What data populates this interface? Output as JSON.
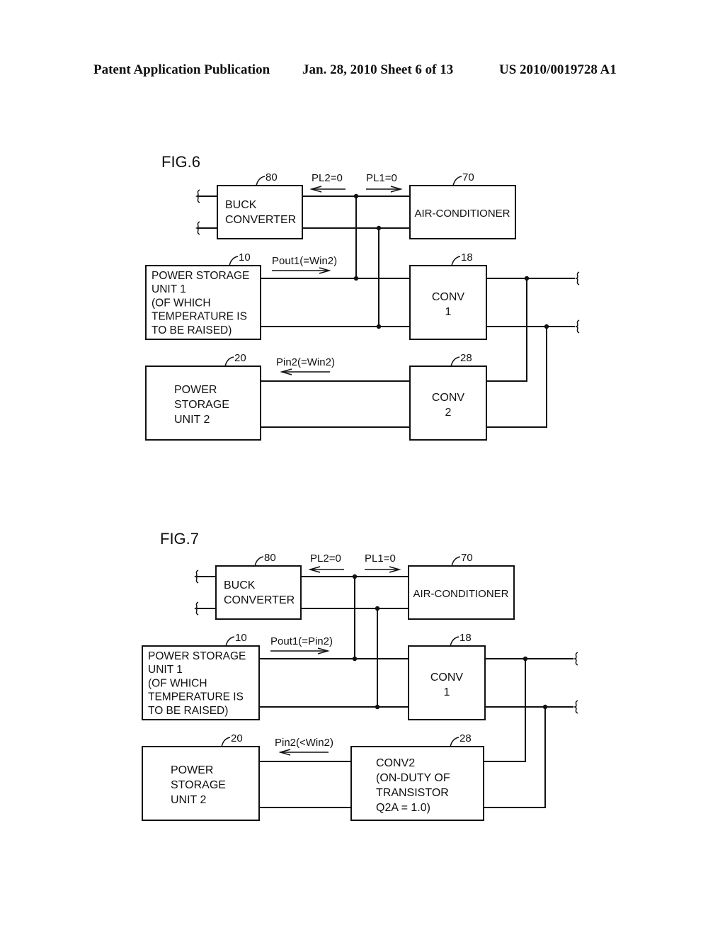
{
  "header": {
    "left": "Patent Application Publication",
    "date_sheet": "Jan. 28, 2010  Sheet 6 of 13",
    "number": "US 2010/0019728 A1"
  },
  "figures": [
    {
      "label": "FIG.6",
      "buck": {
        "ref": "80",
        "lines": [
          "BUCK",
          "CONVERTER"
        ]
      },
      "aircon": {
        "ref": "70",
        "lines": [
          "AIR-CONDITIONER"
        ]
      },
      "unit1": {
        "ref": "10",
        "lines": [
          "POWER STORAGE",
          "UNIT 1",
          "(OF WHICH",
          "TEMPERATURE IS",
          "TO BE RAISED)"
        ]
      },
      "conv1": {
        "ref": "18",
        "lines": [
          "CONV",
          "1"
        ]
      },
      "unit2": {
        "ref": "20",
        "lines": [
          "POWER",
          "STORAGE",
          "UNIT 2"
        ]
      },
      "conv2": {
        "ref": "28",
        "lines": [
          "CONV",
          "2"
        ]
      },
      "pl2": "PL2=0",
      "pl1": "PL1=0",
      "pout1": "Pout1(=Win2)",
      "pin2": "Pin2(=Win2)"
    },
    {
      "label": "FIG.7",
      "buck": {
        "ref": "80",
        "lines": [
          "BUCK",
          "CONVERTER"
        ]
      },
      "aircon": {
        "ref": "70",
        "lines": [
          "AIR-CONDITIONER"
        ]
      },
      "unit1": {
        "ref": "10",
        "lines": [
          "POWER STORAGE",
          "UNIT 1",
          "(OF WHICH",
          "TEMPERATURE IS",
          "TO BE RAISED)"
        ]
      },
      "conv1": {
        "ref": "18",
        "lines": [
          "CONV",
          "1"
        ]
      },
      "unit2": {
        "ref": "20",
        "lines": [
          "POWER",
          "STORAGE",
          "UNIT 2"
        ]
      },
      "conv2": {
        "ref": "28",
        "lines": [
          "CONV2",
          "(ON-DUTY OF",
          "TRANSISTOR",
          "Q2A = 1.0)"
        ]
      },
      "pl2": "PL2=0",
      "pl1": "PL1=0",
      "pout1": "Pout1(=Pin2)",
      "pin2": "Pin2(<Win2)"
    }
  ]
}
